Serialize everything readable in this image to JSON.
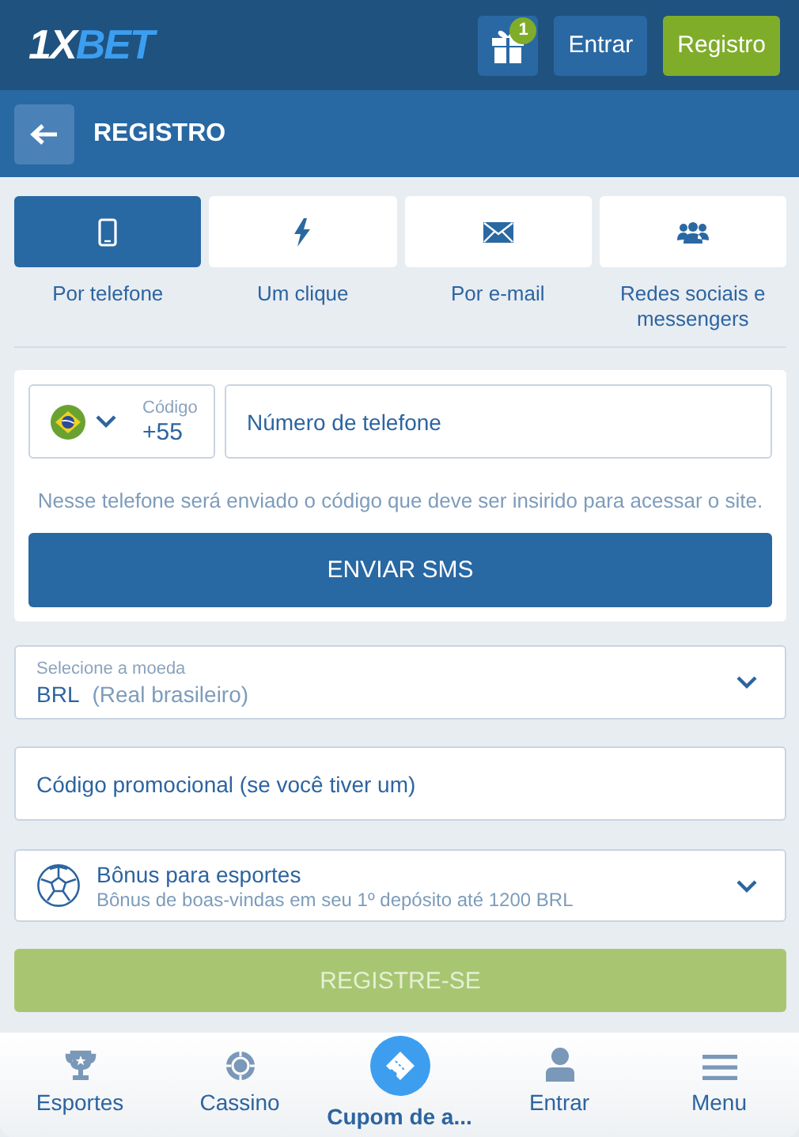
{
  "header": {
    "logo": {
      "prefix": "1X",
      "suffix": "BET"
    },
    "gift_badge": "1",
    "login_button": "Entrar",
    "register_button": "Registro"
  },
  "page_title": "REGISTRO",
  "tabs": [
    {
      "kind": "phone",
      "label": "Por telefone",
      "selected": true
    },
    {
      "kind": "bolt",
      "label": "Um clique",
      "selected": false
    },
    {
      "kind": "mail",
      "label": "Por e-mail",
      "selected": false
    },
    {
      "kind": "people",
      "label": "Redes sociais e messengers",
      "selected": false
    }
  ],
  "phone_form": {
    "code_label": "Código",
    "code_value": "+55",
    "phone_placeholder": "Número de telefone",
    "hint": "Nesse telefone será enviado o código que deve ser insirido para acessar o site.",
    "send_button": "ENVIAR SMS"
  },
  "currency": {
    "label": "Selecione a moeda",
    "code": "BRL",
    "name": "(Real brasileiro)"
  },
  "promo": {
    "placeholder": "Código promocional (se você tiver um)"
  },
  "bonus": {
    "title": "Bônus para esportes",
    "subtitle": "Bônus de boas-vindas em seu 1º depósito até 1200 BRL"
  },
  "submit_button": {
    "label": "REGISTRE-SE",
    "disabled": true
  },
  "bottom_nav": [
    {
      "kind": "trophy",
      "label": "Esportes",
      "selected": false
    },
    {
      "kind": "chip",
      "label": "Cassino",
      "selected": false
    },
    {
      "kind": "ticket",
      "label": "Cupom de a...",
      "selected": true
    },
    {
      "kind": "person",
      "label": "Entrar",
      "selected": false
    },
    {
      "kind": "menu",
      "label": "Menu",
      "selected": false
    }
  ]
}
